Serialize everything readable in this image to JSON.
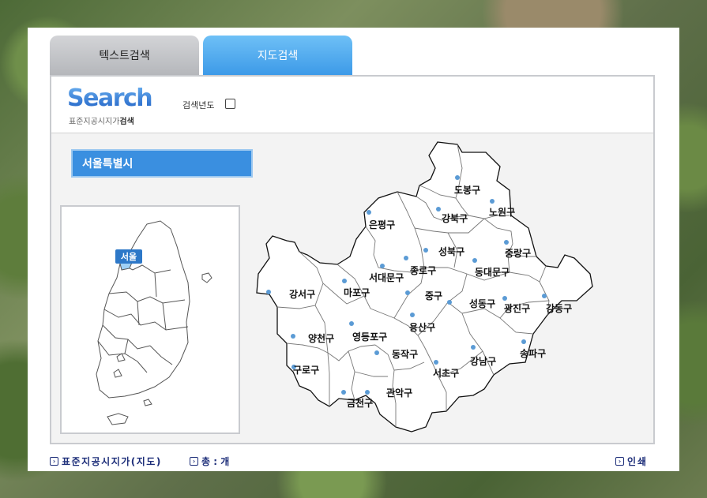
{
  "tabs": [
    {
      "label": "텍스트검색",
      "active": false
    },
    {
      "label": "지도검색",
      "active": true
    }
  ],
  "search_header": {
    "logo": "Search",
    "subtitle_normal": "표준지공시지가",
    "subtitle_bold": "검색",
    "year_label": "검색년도",
    "year_checked": false
  },
  "city_select": {
    "value": "서울특별시"
  },
  "korea_map": {
    "seoul_label": "서울"
  },
  "districts": [
    "도봉구",
    "노원구",
    "강북구",
    "은평구",
    "성북구",
    "중랑구",
    "종로구",
    "서대문구",
    "동대문구",
    "강서구",
    "마포구",
    "중구",
    "성동구",
    "광진구",
    "강동구",
    "용산구",
    "양천구",
    "영등포구",
    "동작구",
    "송파구",
    "구로구",
    "서초구",
    "강남구",
    "관악구",
    "금천구"
  ],
  "footer": {
    "map_link": "표준지공시지가(지도)",
    "total_label": "총 : 개",
    "print_link": "인쇄"
  },
  "colors": {
    "active_tab": "#3d9ae8",
    "city_select_bg": "#3a8fe0",
    "dot": "#5b9bd5",
    "footer_text": "#1e2f7a"
  }
}
